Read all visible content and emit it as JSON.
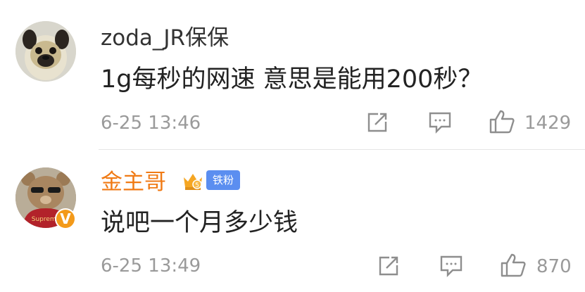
{
  "comments": [
    {
      "username": "zoda_JR保保",
      "text": "1g每秒的网速 意思是能用200秒？",
      "time": "6-25 13:46",
      "likes": "1429",
      "avatar": "pug-dog-avatar"
    },
    {
      "username": "金主哥",
      "fan_badge": "铁粉",
      "verified_mark": "V",
      "text": "说吧一个月多少钱",
      "time": "6-25 13:49",
      "likes": "870",
      "avatar": "teddy-bear-avatar"
    }
  ],
  "icons": {
    "repost": "share-icon",
    "comment": "comment-icon",
    "like": "thumbs-up-icon"
  },
  "colors": {
    "vip_name": "#f07a14",
    "fan_badge": "#5b8ef0",
    "verified": "#f39a1a",
    "icon_gray": "#8e8e8e"
  }
}
